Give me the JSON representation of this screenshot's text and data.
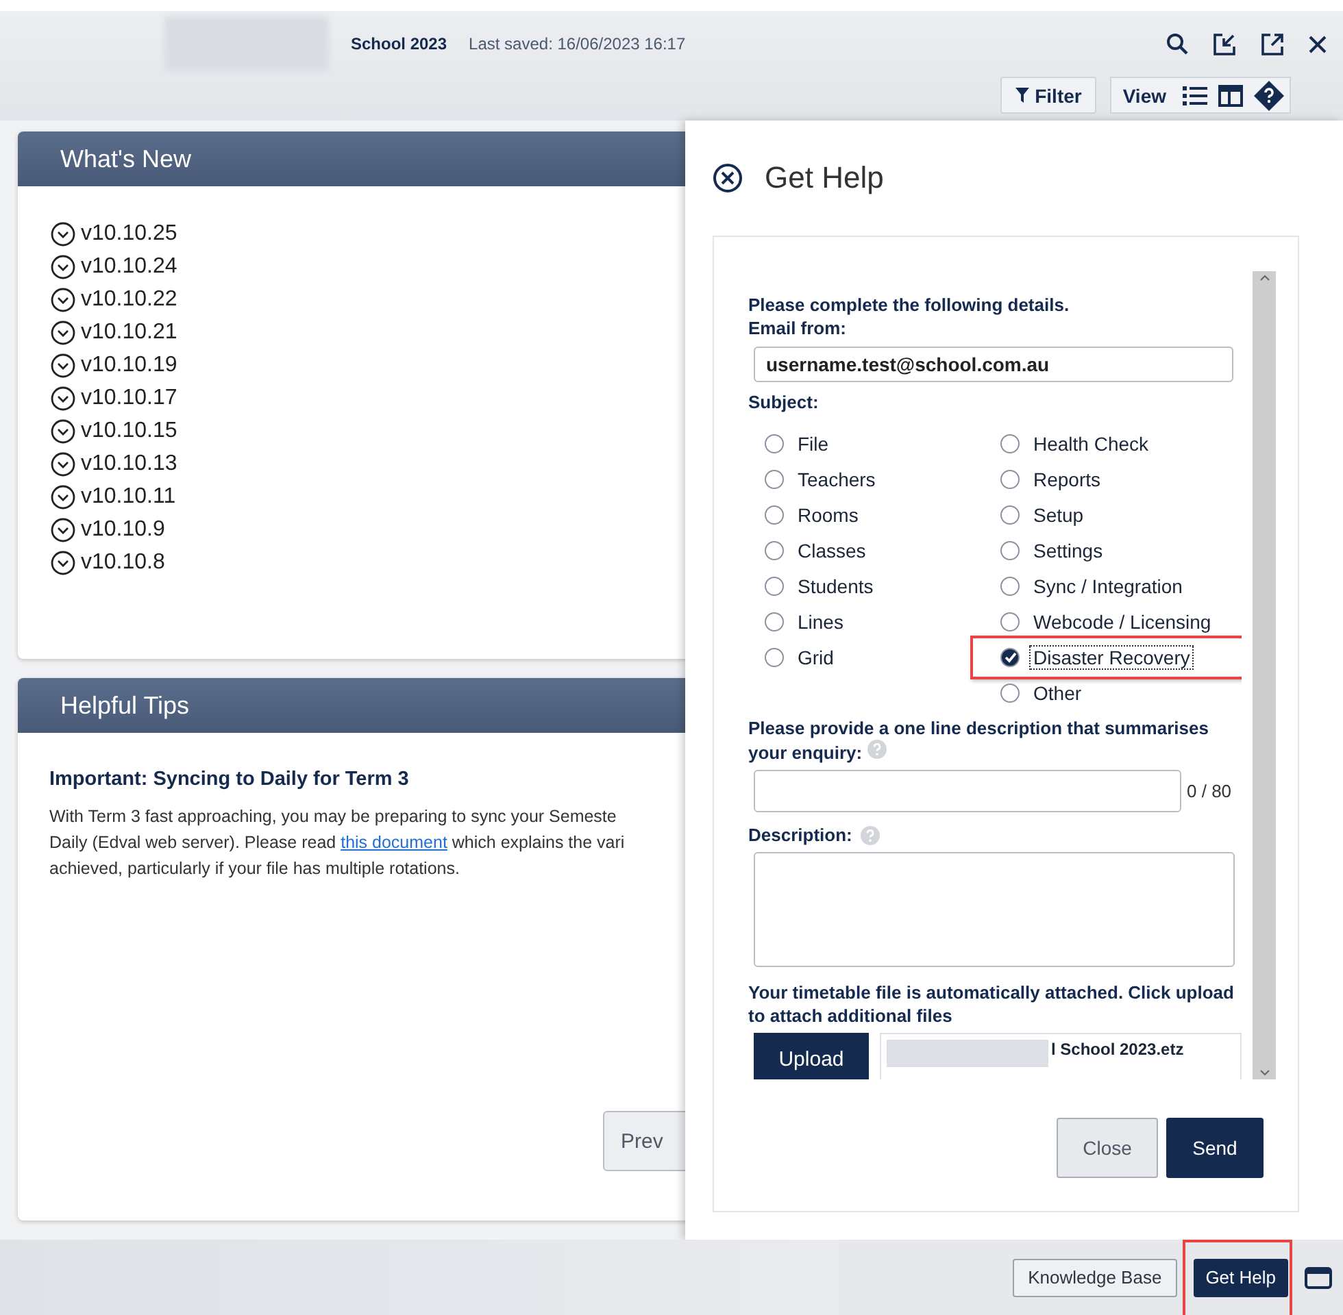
{
  "header": {
    "file_name": "School 2023",
    "last_saved": "Last saved: 16/06/2023 16:17"
  },
  "toolbar": {
    "filter": "Filter",
    "view": "View"
  },
  "whats_new": {
    "title": "What's New",
    "versions": [
      "v10.10.25",
      "v10.10.24",
      "v10.10.22",
      "v10.10.21",
      "v10.10.19",
      "v10.10.17",
      "v10.10.15",
      "v10.10.13",
      "v10.10.11",
      "v10.10.9",
      "v10.10.8"
    ]
  },
  "helpful_tips": {
    "title": "Helpful Tips",
    "heading": "Important: Syncing to Daily for Term 3",
    "line_1": "With Term 3 fast approaching, you may be preparing to sync your Semeste",
    "line_2_before": "Daily (Edval web server). Please read ",
    "link": "this document",
    "line_2_after": " which explains the vari",
    "line_3": "achieved, particularly if your file has multiple rotations.",
    "prev_button": "Prev"
  },
  "dialog": {
    "title": "Get Help",
    "intro": "Please complete the following details.",
    "email_label": "Email from:",
    "email_value": "username.test@school.com.au",
    "subject_label": "Subject:",
    "subject_columns": [
      [
        {
          "label": "File",
          "selected": false
        },
        {
          "label": "Teachers",
          "selected": false
        },
        {
          "label": "Rooms",
          "selected": false
        },
        {
          "label": "Classes",
          "selected": false
        },
        {
          "label": "Students",
          "selected": false
        },
        {
          "label": "Lines",
          "selected": false
        },
        {
          "label": "Grid",
          "selected": false
        }
      ],
      [
        {
          "label": "Health Check",
          "selected": false
        },
        {
          "label": "Reports",
          "selected": false
        },
        {
          "label": "Setup",
          "selected": false
        },
        {
          "label": "Settings",
          "selected": false
        },
        {
          "label": "Sync / Integration",
          "selected": false
        },
        {
          "label": "Webcode / Licensing",
          "selected": false
        },
        {
          "label": "Disaster Recovery",
          "selected": true
        },
        {
          "label": "Other",
          "selected": false
        }
      ]
    ],
    "summary_label": "Please provide a one line description that summarises your enquiry:",
    "counter": "0 / 80",
    "description_label": "Description:",
    "attach_note": "Your timetable file is automatically attached. Click upload to attach additional files",
    "upload_button": "Upload",
    "file_name": "l School 2023.etz",
    "close_button": "Close",
    "send_button": "Send"
  },
  "footer": {
    "knowledge_base": "Knowledge Base",
    "get_help": "Get Help"
  }
}
